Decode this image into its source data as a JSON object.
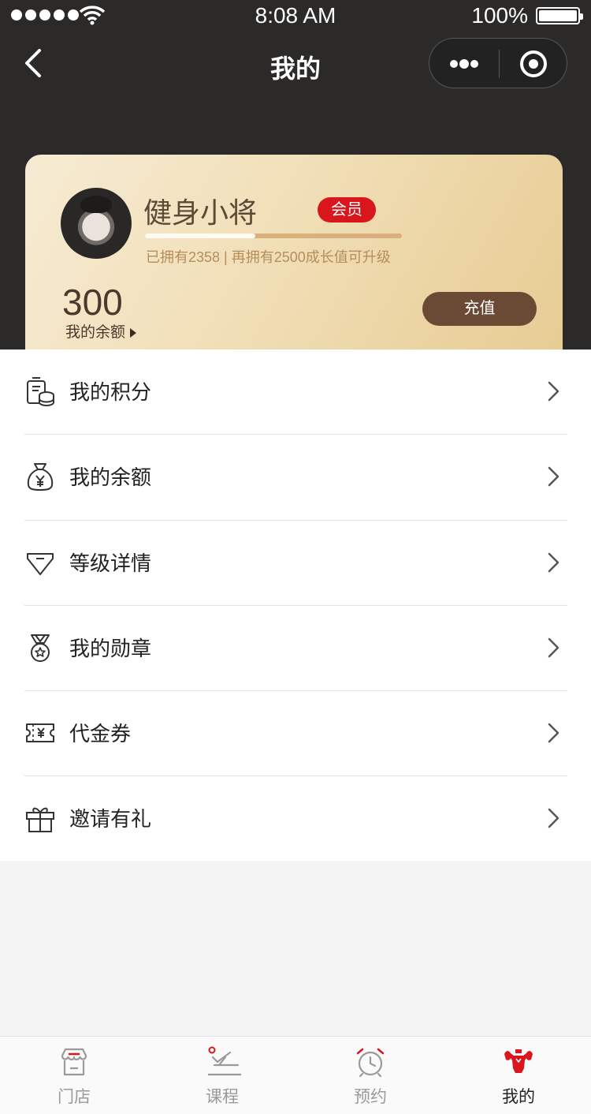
{
  "status_bar": {
    "time": "8:08 AM",
    "battery": "100%"
  },
  "nav": {
    "title": "我的"
  },
  "card": {
    "username": "健身小将",
    "badge": "会员",
    "progress": 0.43,
    "growth_text": "已拥有2358 | 再拥有2500成长值可升级",
    "balance_value": "300",
    "balance_label": "我的余额",
    "recharge_label": "充值"
  },
  "menu": {
    "items": [
      {
        "label": "我的积分",
        "icon": "coins-icon"
      },
      {
        "label": "我的余额",
        "icon": "money-bag-icon"
      },
      {
        "label": "等级详情",
        "icon": "diamond-icon"
      },
      {
        "label": "我的勋章",
        "icon": "medal-icon"
      },
      {
        "label": "代金券",
        "icon": "voucher-icon"
      },
      {
        "label": "邀请有礼",
        "icon": "gift-icon"
      }
    ]
  },
  "tabs": [
    {
      "label": "门店",
      "icon": "store-icon"
    },
    {
      "label": "课程",
      "icon": "course-icon"
    },
    {
      "label": "预约",
      "icon": "alarm-clock-icon"
    },
    {
      "label": "我的",
      "icon": "muscle-man-icon"
    }
  ],
  "colors": {
    "header_bg": "#2b2a29",
    "accent_red": "#d8161c",
    "card_gold": "#e7cc93",
    "button_brown": "#6a4a35"
  }
}
